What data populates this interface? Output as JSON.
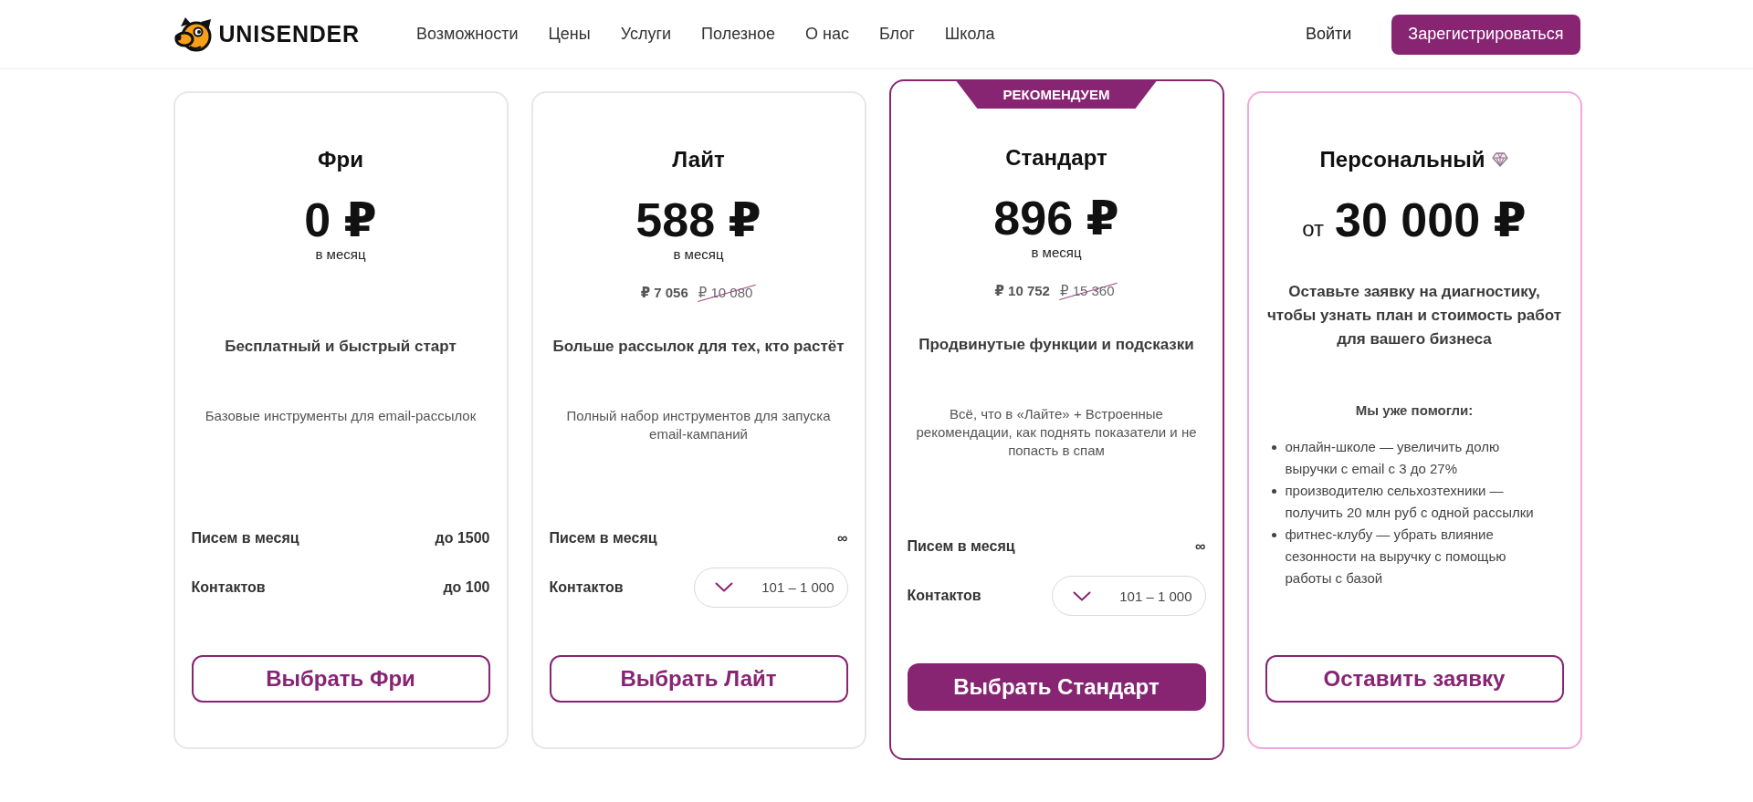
{
  "header": {
    "logo": "UNISENDER",
    "nav": [
      "Возможности",
      "Цены",
      "Услуги",
      "Полезное",
      "О нас",
      "Блог",
      "Школа"
    ],
    "login": "Войти",
    "signup": "Зарегистрироваться"
  },
  "plans": [
    {
      "kind": "plan",
      "recommended": false,
      "name": "Фри",
      "price": "0 ₽",
      "period": "в месяц",
      "subtitle": "Бесплатный и быстрый старт",
      "description": "Базовые инструменты для email-рассылок",
      "features": [
        {
          "kind": "text",
          "label": "Писем в месяц",
          "value": "до 1500"
        },
        {
          "kind": "text",
          "label": "Контактов",
          "value": "до 100"
        }
      ],
      "button": {
        "label": "Выбрать Фри",
        "primary": false
      }
    },
    {
      "kind": "plan",
      "recommended": false,
      "name": "Лайт",
      "price": "588 ₽",
      "period": "в месяц",
      "yearly_price": "₽ 7 056",
      "old_yearly_price": "₽ 10 080",
      "subtitle": "Больше рассылок для тех, кто растёт",
      "description": "Полный набор инструментов для запуска email-кампаний",
      "features": [
        {
          "kind": "text",
          "label": "Писем в месяц",
          "value": "∞"
        },
        {
          "kind": "select",
          "label": "Контактов",
          "value": "101 – 1 000"
        }
      ],
      "button": {
        "label": "Выбрать Лайт",
        "primary": false
      }
    },
    {
      "kind": "plan",
      "recommended": true,
      "badge": "РЕКОМЕНДУЕМ",
      "name": "Стандарт",
      "price": "896 ₽",
      "period": "в месяц",
      "yearly_price": "₽ 10 752",
      "old_yearly_price": "₽ 15 360",
      "subtitle": "Продвинутые функции и подсказки",
      "description": "Всё, что в «Лайте» + Встроенные рекомендации, как поднять показатели и не попасть в спам",
      "features": [
        {
          "kind": "text",
          "label": "Писем в месяц",
          "value": "∞"
        },
        {
          "kind": "select",
          "label": "Контактов",
          "value": "101 – 1 000"
        }
      ],
      "button": {
        "label": "Выбрать Стандарт",
        "primary": true
      }
    },
    {
      "kind": "custom",
      "recommended": false,
      "name": "Персональный",
      "price_prefix": "от",
      "price": "30 000 ₽",
      "description": "Оставьте заявку на диагностику, чтобы узнать план и стоимость работ для вашего бизнеса",
      "list_title": "Мы уже помогли:",
      "cases": [
        "онлайн-школе — увеличить долю выручки с email с 3 до 27%",
        "производителю сельхозтехники — получить 20 млн руб с одной рассылки",
        "фитнес-клубу — убрать влияние сезонности на выручку с помощью работы с базой"
      ],
      "button": {
        "label": "Оставить заявку",
        "primary": false
      }
    }
  ]
}
